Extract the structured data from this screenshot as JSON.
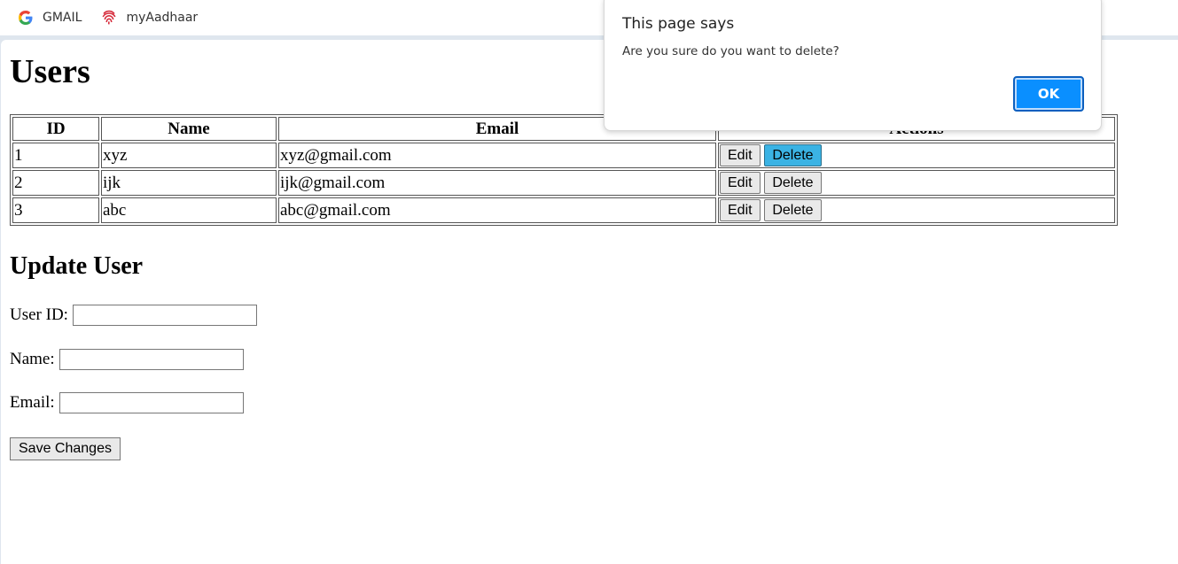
{
  "bookmarks": [
    {
      "label": "GMAIL",
      "icon": "google-icon"
    },
    {
      "label": "myAadhaar",
      "icon": "fingerprint-icon"
    }
  ],
  "page": {
    "title": "Users",
    "table": {
      "headers": [
        "ID",
        "Name",
        "Email",
        "Actions"
      ],
      "rows": [
        {
          "id": "1",
          "name": "xyz",
          "email": "xyz@gmail.com"
        },
        {
          "id": "2",
          "name": "ijk",
          "email": "ijk@gmail.com"
        },
        {
          "id": "3",
          "name": "abc",
          "email": "abc@gmail.com"
        }
      ],
      "edit_label": "Edit",
      "delete_label": "Delete"
    },
    "update": {
      "heading": "Update User",
      "user_id_label": "User ID:",
      "name_label": "Name:",
      "email_label": "Email:",
      "user_id_value": "",
      "name_value": "",
      "email_value": "",
      "save_label": "Save Changes"
    }
  },
  "dialog": {
    "title": "This page says",
    "message": "Are you sure do you want to delete?",
    "ok_label": "OK"
  },
  "colors": {
    "ok_button": "#0a8fff",
    "delete_active": "#3bb3e4",
    "chrome_bg": "#dfe6ee"
  }
}
